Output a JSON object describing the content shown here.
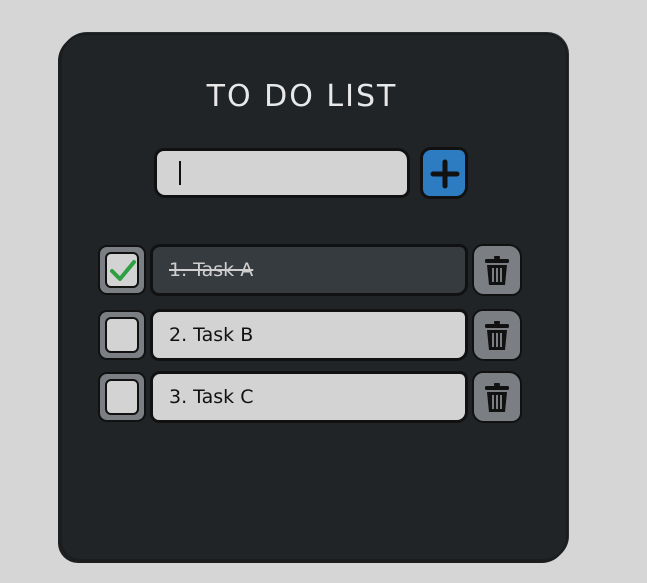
{
  "title": "TO DO LIST",
  "input": {
    "value": "",
    "placeholder": ""
  },
  "add_button": {
    "icon": "plus-icon",
    "color": "#2d7cc2"
  },
  "tasks": [
    {
      "label": "1. Task A",
      "done": true
    },
    {
      "label": "2. Task B",
      "done": false
    },
    {
      "label": "3. Task C",
      "done": false
    }
  ],
  "colors": {
    "background": "#d6d6d6",
    "card": "#212427",
    "task_bg": "#d3d3d3",
    "task_done_bg": "#363b40",
    "check_green": "#2ea043",
    "delete_bg": "#7b7f84"
  },
  "icons": {
    "checkbox": "checkmark-icon",
    "delete": "trash-icon"
  }
}
